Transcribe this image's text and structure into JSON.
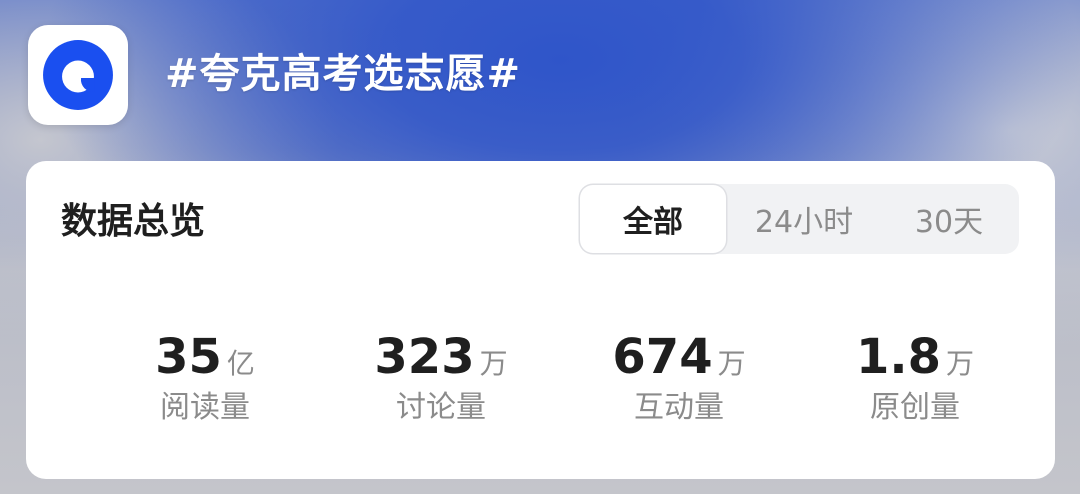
{
  "header": {
    "app_icon": "quark-logo-icon",
    "topic_title": "#夸克高考选志愿#"
  },
  "overview": {
    "title": "数据总览",
    "tabs": [
      {
        "label": "全部",
        "selected": true
      },
      {
        "label": "24小时",
        "selected": false
      },
      {
        "label": "30天",
        "selected": false
      }
    ],
    "stats": [
      {
        "value": "35",
        "unit": "亿",
        "label": "阅读量"
      },
      {
        "value": "323",
        "unit": "万",
        "label": "讨论量"
      },
      {
        "value": "674",
        "unit": "万",
        "label": "互动量"
      },
      {
        "value": "1.8",
        "unit": "万",
        "label": "原创量"
      }
    ]
  },
  "colors": {
    "brand_blue": "#1a4ff0",
    "banner_blue": "#2f55c9",
    "card_bg": "#ffffff",
    "text_primary": "#1f1f1f",
    "text_secondary": "#8b8b8b"
  }
}
